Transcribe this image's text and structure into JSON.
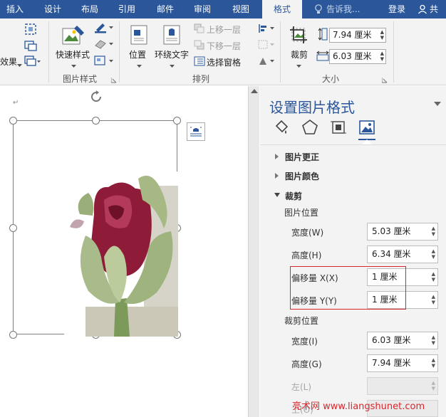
{
  "tabs": [
    "插入",
    "设计",
    "布局",
    "引用",
    "邮件",
    "审阅",
    "视图",
    "格式"
  ],
  "tell_me": "告诉我...",
  "login": "登录",
  "share": "共享",
  "ribbon": {
    "effects_partial": "效果",
    "quick_styles": "快速样式",
    "group_picture_styles": "图片样式",
    "position": "位置",
    "wrap_text": "环绕文字",
    "bring_forward": "上移一层",
    "send_backward": "下移一层",
    "selection_pane": "选择窗格",
    "group_arrange": "排列",
    "crop": "裁剪",
    "height_value": "7.94 厘米",
    "width_value": "6.03 厘米",
    "group_size": "大小"
  },
  "pane": {
    "title": "设置图片格式",
    "sections": {
      "corrections": "图片更正",
      "color": "图片颜色",
      "crop": "裁剪"
    },
    "picture_position": "图片位置",
    "pp_width_label": "宽度(W)",
    "pp_width_value": "5.03 厘米",
    "pp_height_label": "高度(H)",
    "pp_height_value": "6.34 厘米",
    "offset_x_label": "偏移量 X(X)",
    "offset_x_value": "1 厘米",
    "offset_y_label": "偏移量 Y(Y)",
    "offset_y_value": "1 厘米",
    "crop_position": "裁剪位置",
    "cp_width_label": "宽度(I)",
    "cp_width_value": "6.03 厘米",
    "cp_height_label": "高度(G)",
    "cp_height_value": "7.94 厘米",
    "left_label": "左(L)",
    "top_label": "上(O)"
  },
  "watermark": "亮术网 www.liangshunet.com",
  "colors": {
    "brand": "#2b579a",
    "highlight": "#d9262b"
  }
}
